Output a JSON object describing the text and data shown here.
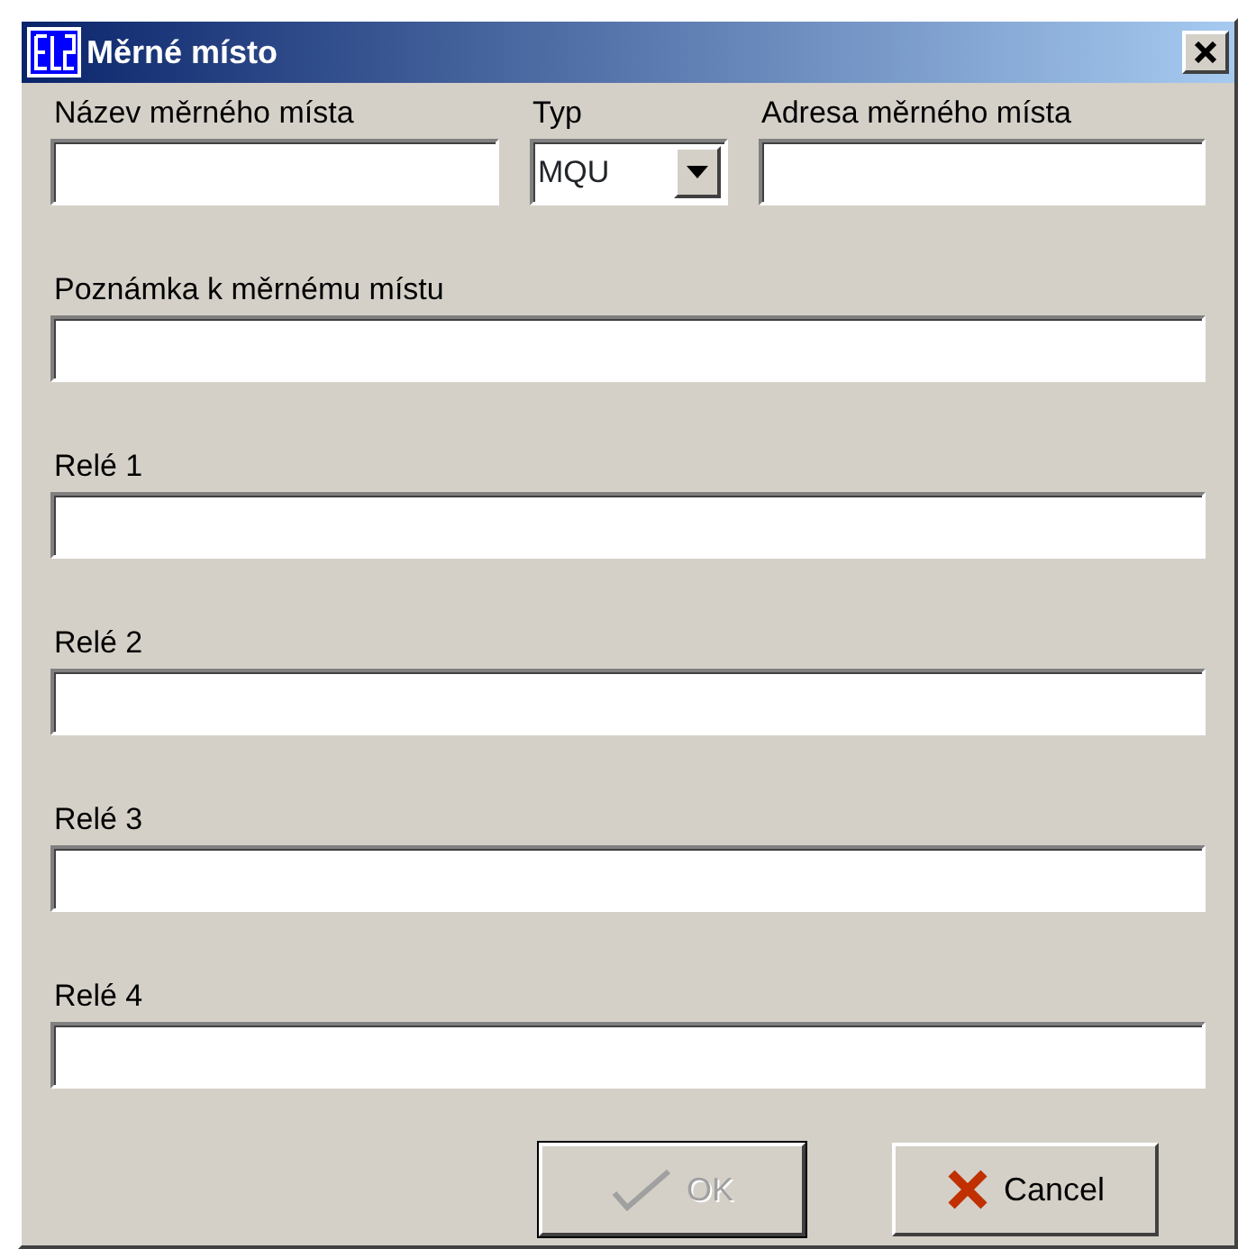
{
  "window": {
    "title": "Měrné místo"
  },
  "top_row": [
    {
      "kind": "text",
      "label": "Název měrného místa"
    },
    {
      "kind": "combo",
      "label": "Typ",
      "value": "MQU"
    },
    {
      "kind": "text",
      "label": "Adresa měrného místa"
    }
  ],
  "fields": [
    {
      "label": "Poznámka k měrnému místu"
    },
    {
      "label": "Relé 1"
    },
    {
      "label": "Relé 2"
    },
    {
      "label": "Relé 3"
    },
    {
      "label": "Relé 4"
    }
  ],
  "buttons": [
    {
      "kind": "ok",
      "label": "OK",
      "disabled": true
    },
    {
      "kind": "cancel",
      "label": "Cancel",
      "disabled": false
    }
  ]
}
